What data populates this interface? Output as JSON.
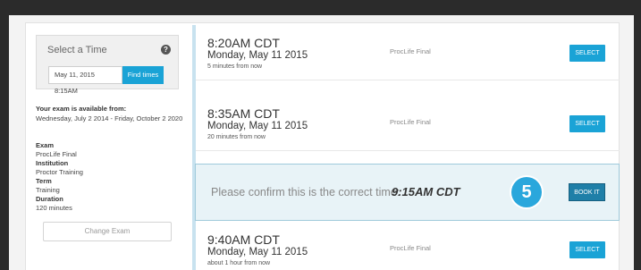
{
  "sidebar": {
    "select_time_title": "Select a Time",
    "help_icon": "?",
    "date_value": "May 11, 2015  8:15AM",
    "find_times_label": "Find times",
    "availability_label": "Your exam is available from:",
    "availability_dates": "Wednesday, July 2 2014 - Friday, October 2 2020",
    "exam_label": "Exam",
    "exam_value": "ProcLife Final",
    "institution_label": "Institution",
    "institution_value": "Proctor Training",
    "term_label": "Term",
    "term_value": "Training",
    "duration_label": "Duration",
    "duration_value": "120 minutes",
    "change_exam_label": "Change Exam"
  },
  "slots": [
    {
      "time": "8:20AM CDT",
      "day": "Monday, May 11 2015",
      "relative": "5 minutes from now",
      "exam": "ProcLife Final",
      "button": "SELECT"
    },
    {
      "time": "8:35AM CDT",
      "day": "Monday, May 11 2015",
      "relative": "20 minutes from now",
      "exam": "ProcLife Final",
      "button": "SELECT"
    },
    {
      "time": "9:40AM CDT",
      "day": "Monday, May 11 2015",
      "relative": "about 1 hour from now",
      "exam": "ProcLife Final",
      "button": "SELECT"
    }
  ],
  "confirm": {
    "text": "Please confirm this is the correct time:",
    "time": "9:15AM CDT",
    "step": "5",
    "button": "BOOK IT"
  },
  "colors": {
    "accent": "#1aa3d6",
    "book": "#1f7fa8",
    "confirm_bg": "#e8f3f7"
  }
}
